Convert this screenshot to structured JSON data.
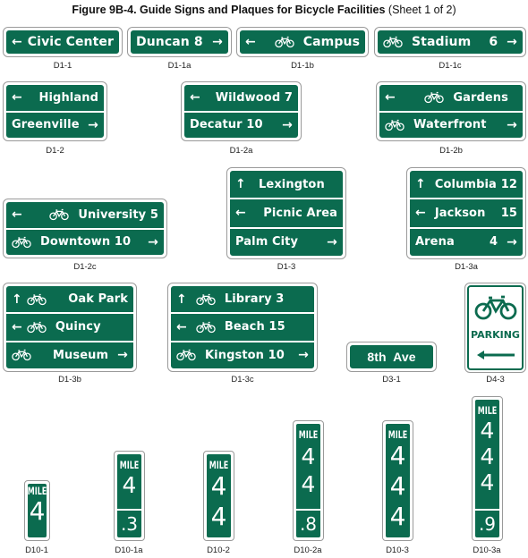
{
  "figure": {
    "title_bold": "Figure 9B-4.  Guide Signs and Plaques for Bicycle Facilities",
    "title_sheet": " (Sheet 1 of 2)"
  },
  "colors": {
    "sign_green": "#0b6b4f",
    "legend_white": "#ffffff"
  },
  "icons": {
    "left": "←",
    "right": "→",
    "up": "↑",
    "bike": "bicycle-icon"
  },
  "signs": {
    "d1_1": {
      "code": "D1-1",
      "rows": [
        {
          "arrow_left": "←",
          "text": "Civic Center"
        }
      ]
    },
    "d1_1a": {
      "code": "D1-1a",
      "rows": [
        {
          "text": "Duncan 8",
          "arrow_right": "→"
        }
      ]
    },
    "d1_1b": {
      "code": "D1-1b",
      "rows": [
        {
          "arrow_left": "←",
          "bike": true,
          "text": "Campus"
        }
      ]
    },
    "d1_1c": {
      "code": "D1-1c",
      "rows": [
        {
          "bike": true,
          "text": "Stadium",
          "distance": "6",
          "arrow_right": "→"
        }
      ]
    },
    "d1_2": {
      "code": "D1-2",
      "rows": [
        {
          "arrow_left": "←",
          "text": "Highland"
        },
        {
          "text": "Greenville",
          "arrow_right": "→"
        }
      ]
    },
    "d1_2a": {
      "code": "D1-2a",
      "rows": [
        {
          "arrow_left": "←",
          "text": "Wildwood 7"
        },
        {
          "text": "Decatur 10",
          "arrow_right": "→"
        }
      ]
    },
    "d1_2b": {
      "code": "D1-2b",
      "rows": [
        {
          "arrow_left": "←",
          "bike": true,
          "text": "Gardens"
        },
        {
          "bike": true,
          "text": "Waterfront",
          "arrow_right": "→"
        }
      ]
    },
    "d1_2c": {
      "code": "D1-2c",
      "rows": [
        {
          "arrow_left": "←",
          "bike": true,
          "text": "University 5"
        },
        {
          "bike": true,
          "text": "Downtown 10",
          "arrow_right": "→"
        }
      ]
    },
    "d1_3": {
      "code": "D1-3",
      "rows": [
        {
          "arrow_up": "↑",
          "text": "Lexington"
        },
        {
          "arrow_left": "←",
          "text": "Picnic Area"
        },
        {
          "text": "Palm City",
          "arrow_right": "→"
        }
      ]
    },
    "d1_3a": {
      "code": "D1-3a",
      "rows": [
        {
          "arrow_up": "↑",
          "text": "Columbia",
          "distance": "12"
        },
        {
          "arrow_left": "←",
          "text": "Jackson",
          "distance": "15"
        },
        {
          "text": "Arena",
          "distance": "4",
          "arrow_right": "→"
        }
      ]
    },
    "d1_3b": {
      "code": "D1-3b",
      "rows": [
        {
          "arrow_up": "↑",
          "bike": true,
          "text": "Oak Park"
        },
        {
          "arrow_left": "←",
          "bike": true,
          "text": "Quincy"
        },
        {
          "bike": true,
          "text": "Museum",
          "arrow_right": "→"
        }
      ]
    },
    "d1_3c": {
      "code": "D1-3c",
      "rows": [
        {
          "arrow_up": "↑",
          "bike": true,
          "text": "Library 3"
        },
        {
          "arrow_left": "←",
          "bike": true,
          "text": "Beach 15"
        },
        {
          "bike": true,
          "text": "Kingston 10",
          "arrow_right": "→"
        }
      ]
    },
    "d3_1": {
      "code": "D3-1",
      "rows": [
        {
          "text": "8th  Ave"
        }
      ]
    },
    "d4_3": {
      "code": "D4-3",
      "text": "PARKING",
      "arrow_left": "←"
    }
  },
  "mileposts": {
    "d10_1": {
      "code": "D10-1",
      "word": "MILE",
      "digits": [
        "4"
      ],
      "decimal": ""
    },
    "d10_1a": {
      "code": "D10-1a",
      "word": "MILE",
      "digits": [
        "4"
      ],
      "decimal": ".3"
    },
    "d10_2": {
      "code": "D10-2",
      "word": "MILE",
      "digits": [
        "4",
        "4"
      ],
      "decimal": ""
    },
    "d10_2a": {
      "code": "D10-2a",
      "word": "MILE",
      "digits": [
        "4",
        "4"
      ],
      "decimal": ".8"
    },
    "d10_3": {
      "code": "D10-3",
      "word": "MILE",
      "digits": [
        "4",
        "4",
        "4"
      ],
      "decimal": ""
    },
    "d10_3a": {
      "code": "D10-3a",
      "word": "MILE",
      "digits": [
        "4",
        "4",
        "4"
      ],
      "decimal": ".9"
    }
  }
}
